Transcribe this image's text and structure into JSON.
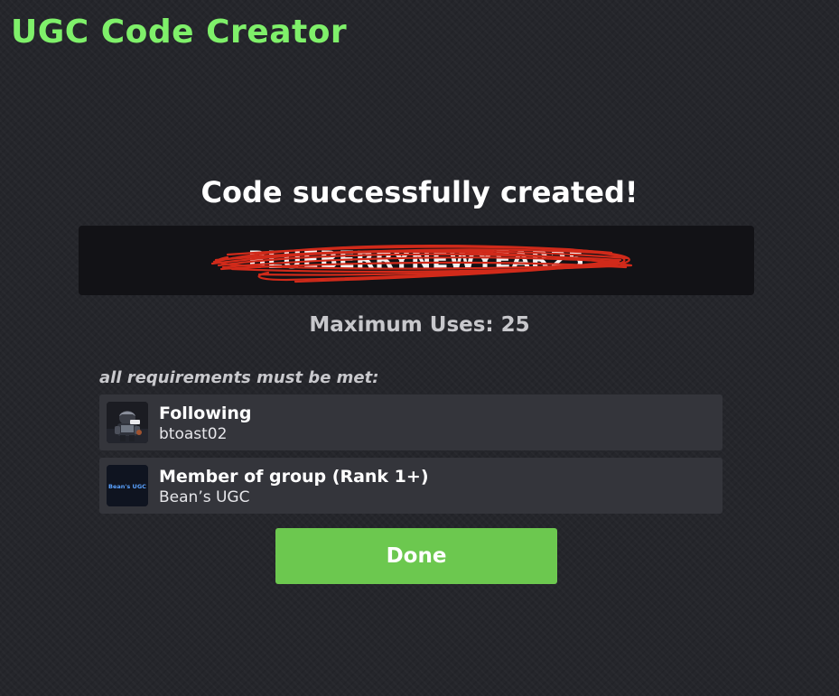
{
  "app": {
    "title": "UGC Code Creator",
    "accent_color": "#7ff06a"
  },
  "result": {
    "heading": "Code successfully created!",
    "code": "BLUEBERRYNEWYEAR25",
    "code_redaction_color": "#d12a1a",
    "max_uses_label": "Maximum Uses:",
    "max_uses_value": "25"
  },
  "requirements": {
    "heading": "all requirements must be met:",
    "items": [
      {
        "title": "Following",
        "subtitle": "btoast02",
        "icon": "user-avatar-icon"
      },
      {
        "title": "Member of group (Rank 1+)",
        "subtitle": "Bean’s UGC",
        "icon": "group-logo-icon",
        "logo_text": "Bean's UGC"
      }
    ]
  },
  "actions": {
    "done_label": "Done",
    "done_color": "#6cc84f"
  }
}
